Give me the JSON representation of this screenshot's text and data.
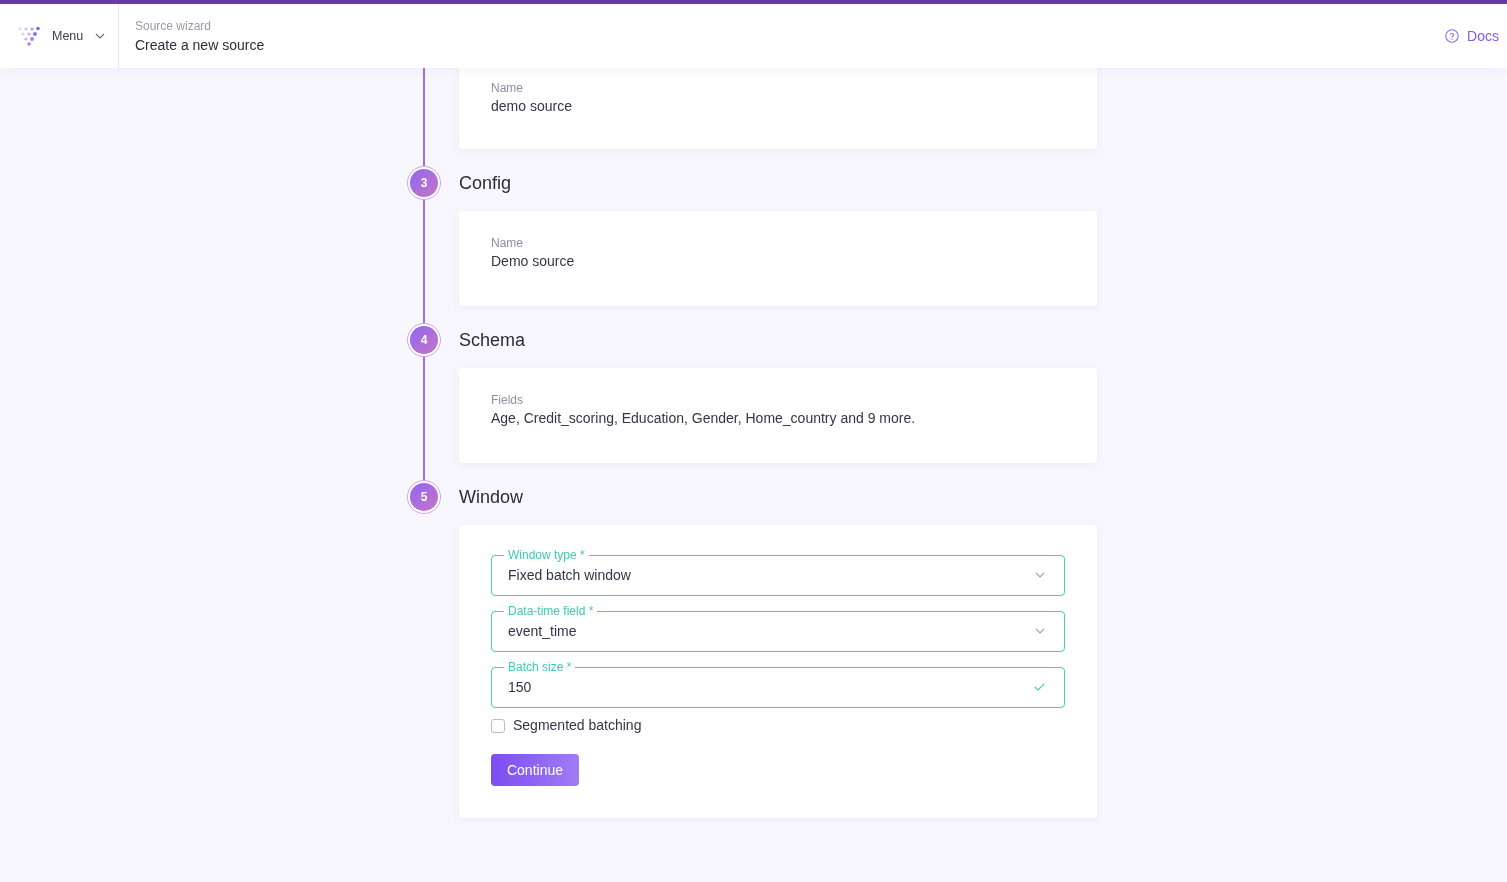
{
  "header": {
    "menu_label": "Menu",
    "breadcrumb": "Source wizard",
    "title": "Create a new source",
    "docs_label": "Docs"
  },
  "steps": [
    {
      "kind": "summary",
      "fields": [
        {
          "label": "Name",
          "value": "demo source"
        }
      ]
    },
    {
      "kind": "summary",
      "number": "3",
      "title": "Config",
      "fields": [
        {
          "label": "Name",
          "value": "Demo source"
        }
      ]
    },
    {
      "kind": "summary",
      "number": "4",
      "title": "Schema",
      "fields": [
        {
          "label": "Fields",
          "value": "Age, Credit_scoring, Education, Gender, Home_country and 9 more."
        }
      ]
    },
    {
      "kind": "form",
      "number": "5",
      "title": "Window",
      "fields": [
        {
          "kind": "select",
          "label": "Window type *",
          "value": "Fixed batch window",
          "valid": true
        },
        {
          "kind": "select",
          "label": "Data-time field *",
          "value": "event_time",
          "valid": true
        },
        {
          "kind": "text",
          "label": "Batch size *",
          "value": "150",
          "valid": true
        }
      ],
      "checkbox": {
        "label": "Segmented batching",
        "checked": false
      },
      "button": "Continue"
    }
  ]
}
